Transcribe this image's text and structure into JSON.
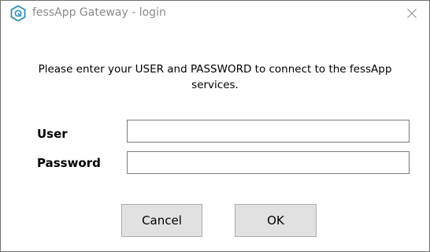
{
  "window": {
    "title": "fessApp Gateway - login",
    "icon": "fessapp-logo-icon",
    "accent_color": "#2b8fc4"
  },
  "message": "Please enter your USER and PASSWORD to connect to the fessApp services.",
  "form": {
    "user_label": "User",
    "user_value": "",
    "password_label": "Password",
    "password_value": ""
  },
  "buttons": {
    "cancel_label": "Cancel",
    "ok_label": "OK"
  }
}
